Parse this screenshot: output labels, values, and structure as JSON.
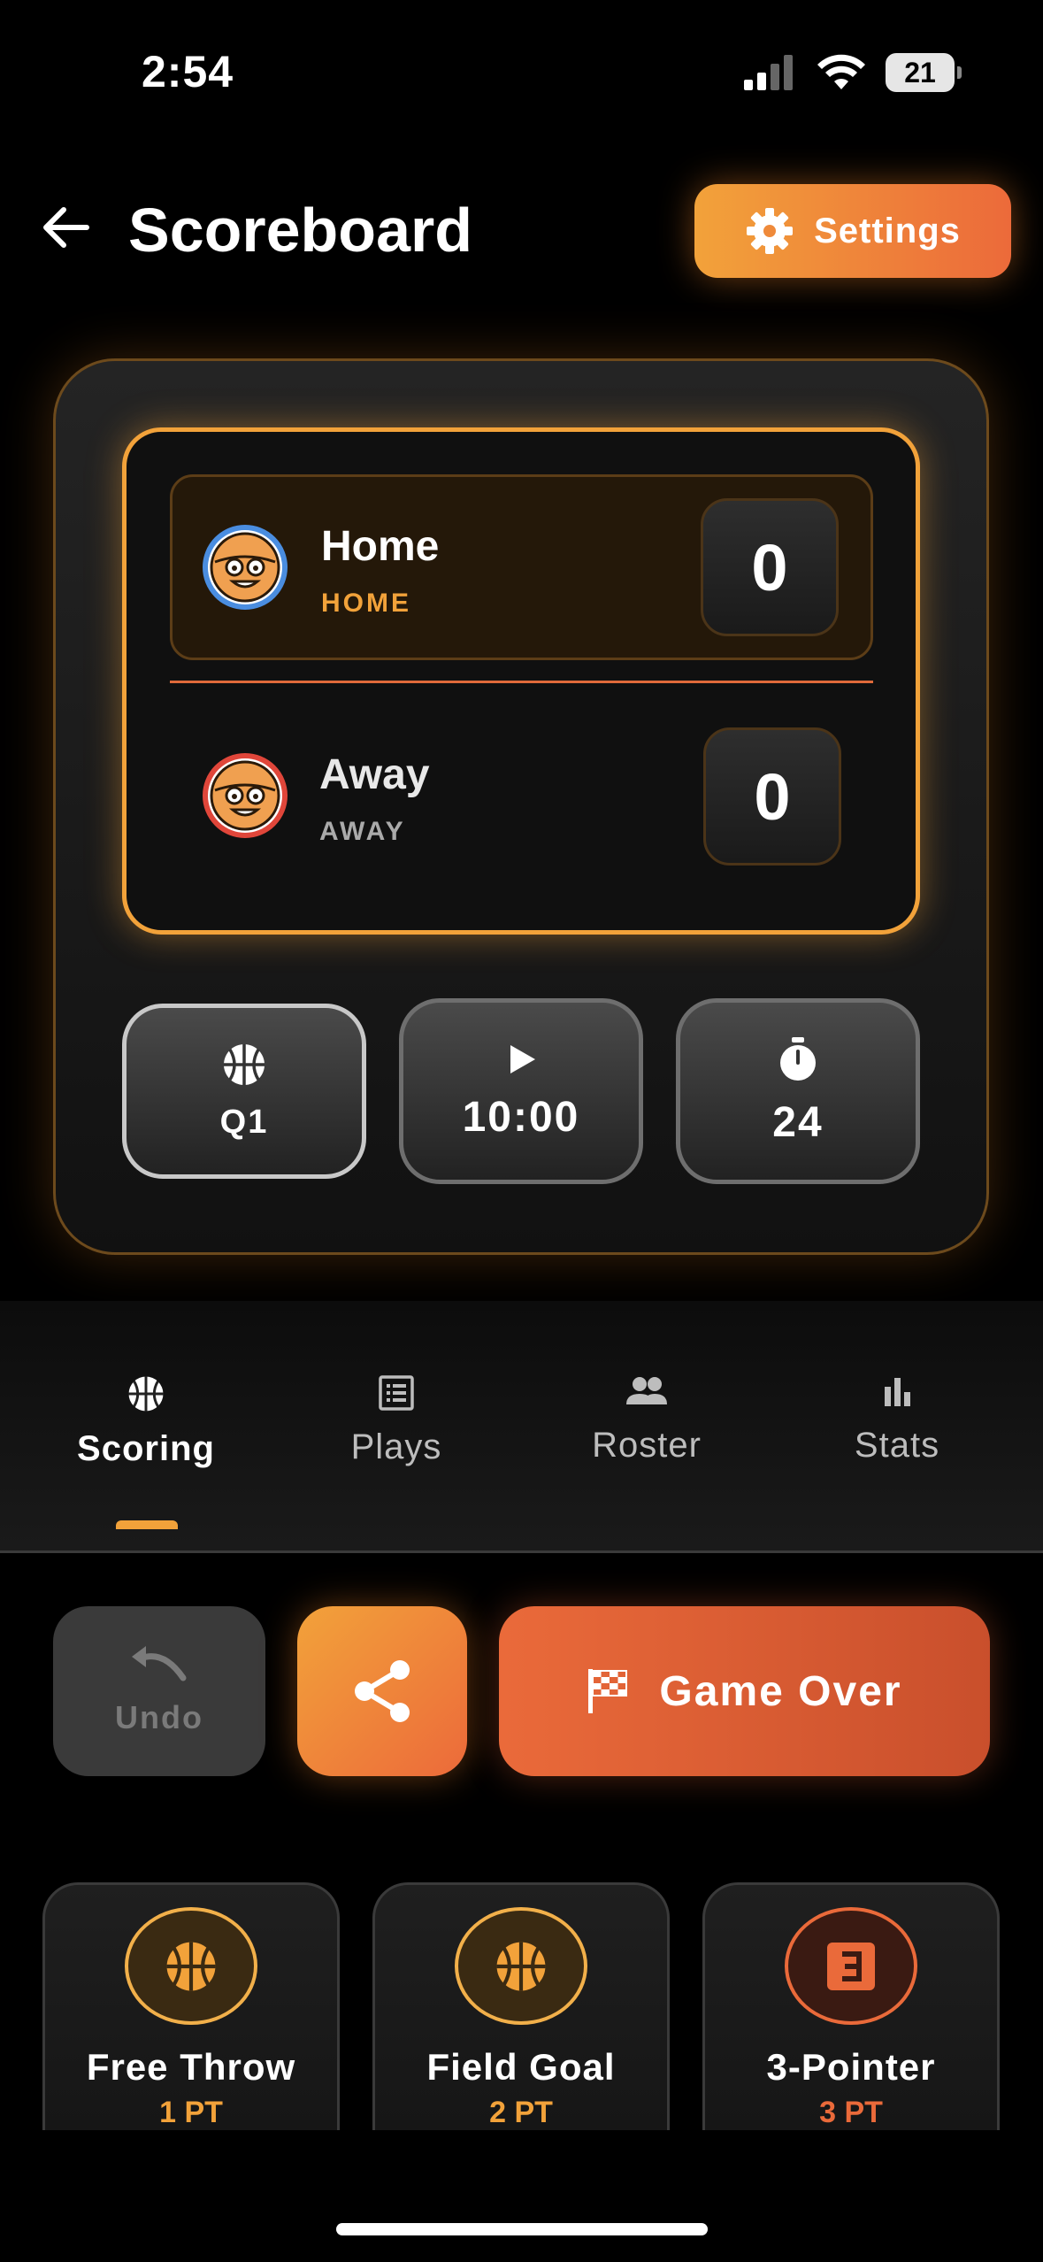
{
  "status_bar": {
    "time": "2:54",
    "battery": "21"
  },
  "header": {
    "title": "Scoreboard",
    "settings_label": "Settings"
  },
  "home": {
    "name": "Home",
    "code": "HOME",
    "score": "0"
  },
  "away": {
    "name": "Away",
    "code": "AWAY",
    "score": "0"
  },
  "controls": {
    "quarter": "Q1",
    "game_clock": "10:00",
    "shot_clock": "24"
  },
  "tabs": [
    {
      "label": "Scoring",
      "icon": "basketball-icon",
      "active": true
    },
    {
      "label": "Plays",
      "icon": "list-icon"
    },
    {
      "label": "Roster",
      "icon": "people-icon"
    },
    {
      "label": "Stats",
      "icon": "bar-chart-icon"
    }
  ],
  "actions": {
    "undo_label": "Undo",
    "game_over_label": "Game Over"
  },
  "score_tiles": [
    {
      "label": "Free Throw",
      "sub": "1 PT",
      "icon": "basketball-icon"
    },
    {
      "label": "Field Goal",
      "sub": "2 PT",
      "icon": "basketball-icon"
    },
    {
      "label": "3-Pointer",
      "sub": "3 PT",
      "icon": "three-icon"
    }
  ],
  "colors": {
    "accent": "#f2a23a",
    "accent_red": "#ec6a3a",
    "home_ring": "#4a8de0",
    "away_ring": "#e0463a"
  }
}
